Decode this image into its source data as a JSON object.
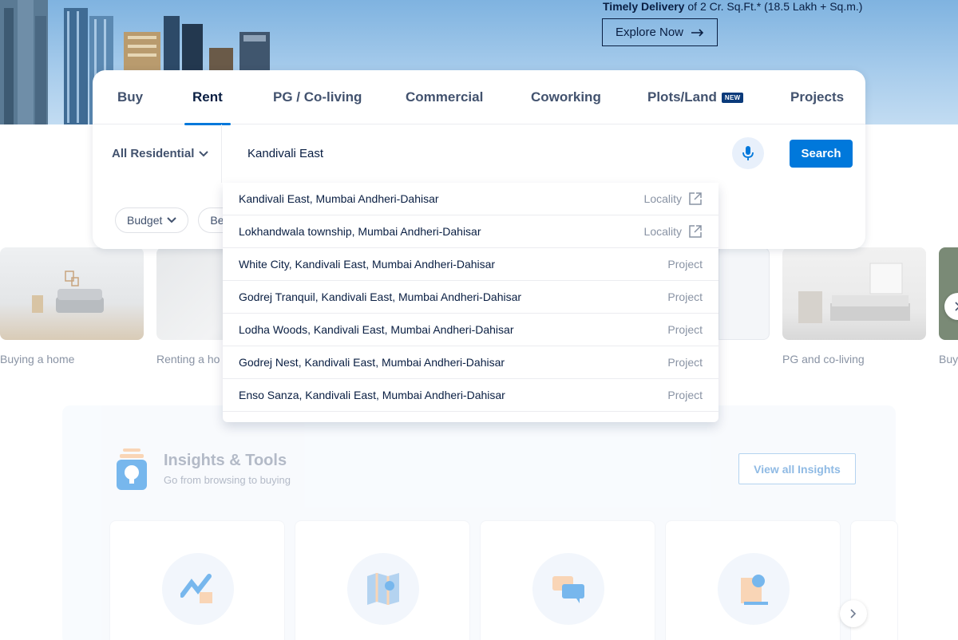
{
  "hero": {
    "delivery_bold": "Timely Delivery",
    "delivery_rest": "of 2 Cr. Sq.Ft.* (18.5 Lakh + Sq.m.)",
    "explore_label": "Explore Now"
  },
  "tabs": [
    {
      "label": "Buy"
    },
    {
      "label": "Rent"
    },
    {
      "label": "PG / Co-living"
    },
    {
      "label": "Commercial"
    },
    {
      "label": "Coworking"
    },
    {
      "label": "Plots/Land",
      "badge": "NEW"
    },
    {
      "label": "Projects"
    }
  ],
  "active_tab": "Rent",
  "search": {
    "property_type": "All Residential",
    "value": "Kandivali East",
    "button_label": "Search"
  },
  "filters": {
    "budget": "Budget",
    "second_partial": "Be"
  },
  "suggestions": [
    {
      "text": "Kandivali East, Mumbai Andheri-Dahisar",
      "type": "Locality"
    },
    {
      "text": "Lokhandwala township, Mumbai Andheri-Dahisar",
      "type": "Locality"
    },
    {
      "text": "White City, Kandivali East, Mumbai Andheri-Dahisar",
      "type": "Project"
    },
    {
      "text": "Godrej Tranquil, Kandivali East, Mumbai Andheri-Dahisar",
      "type": "Project"
    },
    {
      "text": "Lodha Woods, Kandivali East, Mumbai Andheri-Dahisar",
      "type": "Project"
    },
    {
      "text": "Godrej Nest, Kandivali East, Mumbai Andheri-Dahisar",
      "type": "Project"
    },
    {
      "text": "Enso Sanza, Kandivali East, Mumbai Andheri-Dahisar",
      "type": "Project"
    }
  ],
  "categories": [
    {
      "label": "Buying a home"
    },
    {
      "label": "Renting a ho"
    },
    {
      "label": "PG and co-living"
    },
    {
      "label": "Buy"
    }
  ],
  "insights": {
    "title": "Insights & Tools",
    "subtitle": "Go from browsing to buying",
    "view_all_label": "View all Insights"
  },
  "colors": {
    "accent": "#0078db",
    "text_dark": "#091e42",
    "text_muted": "#8993a4"
  }
}
